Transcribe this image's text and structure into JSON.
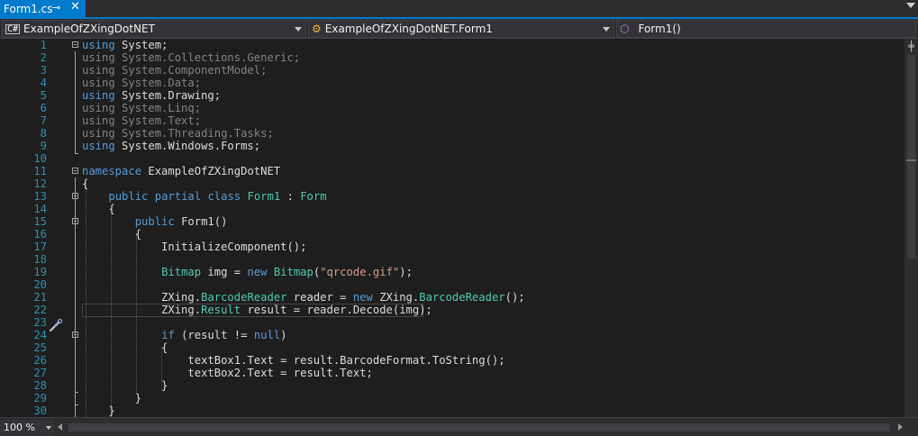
{
  "tab": {
    "title": "Form1.cs",
    "pin_glyph": "⊸",
    "close_glyph": "✕"
  },
  "nav": {
    "project": "ExampleOfZXingDotNET",
    "type": "ExampleOfZXingDotNET.Form1",
    "member": "Form1()"
  },
  "zoom": "100 %",
  "lines": [
    {
      "n": "1",
      "tokens": [
        [
          "kw",
          "using"
        ],
        [
          "tx",
          " System;"
        ]
      ]
    },
    {
      "n": "2",
      "tokens": [
        [
          "gr",
          "using System.Collections.Generic;"
        ]
      ]
    },
    {
      "n": "3",
      "tokens": [
        [
          "gr",
          "using System.ComponentModel;"
        ]
      ]
    },
    {
      "n": "4",
      "tokens": [
        [
          "gr",
          "using System.Data;"
        ]
      ]
    },
    {
      "n": "5",
      "tokens": [
        [
          "kw",
          "using"
        ],
        [
          "tx",
          " System.Drawing;"
        ]
      ]
    },
    {
      "n": "6",
      "tokens": [
        [
          "gr",
          "using System.Linq;"
        ]
      ]
    },
    {
      "n": "7",
      "tokens": [
        [
          "gr",
          "using System.Text;"
        ]
      ]
    },
    {
      "n": "8",
      "tokens": [
        [
          "gr",
          "using System.Threading.Tasks;"
        ]
      ]
    },
    {
      "n": "9",
      "tokens": [
        [
          "kw",
          "using"
        ],
        [
          "tx",
          " System.Windows.Forms;"
        ]
      ]
    },
    {
      "n": "10",
      "tokens": []
    },
    {
      "n": "11",
      "tokens": [
        [
          "kw",
          "namespace"
        ],
        [
          "tx",
          " ExampleOfZXingDotNET"
        ]
      ]
    },
    {
      "n": "12",
      "tokens": [
        [
          "tx",
          "{"
        ]
      ]
    },
    {
      "n": "13",
      "tokens": [
        [
          "tx",
          "    "
        ],
        [
          "kw",
          "public"
        ],
        [
          "tx",
          " "
        ],
        [
          "kw",
          "partial"
        ],
        [
          "tx",
          " "
        ],
        [
          "kw",
          "class"
        ],
        [
          "tx",
          " "
        ],
        [
          "ty",
          "Form1"
        ],
        [
          "tx",
          " : "
        ],
        [
          "ty",
          "Form"
        ]
      ]
    },
    {
      "n": "14",
      "tokens": [
        [
          "tx",
          "    {"
        ]
      ]
    },
    {
      "n": "15",
      "tokens": [
        [
          "tx",
          "        "
        ],
        [
          "kw",
          "public"
        ],
        [
          "tx",
          " Form1()"
        ]
      ]
    },
    {
      "n": "16",
      "tokens": [
        [
          "tx",
          "        {"
        ]
      ]
    },
    {
      "n": "17",
      "tokens": [
        [
          "tx",
          "            InitializeComponent();"
        ]
      ]
    },
    {
      "n": "18",
      "tokens": []
    },
    {
      "n": "19",
      "tokens": [
        [
          "tx",
          "            "
        ],
        [
          "ty",
          "Bitmap"
        ],
        [
          "tx",
          " img = "
        ],
        [
          "kw",
          "new"
        ],
        [
          "tx",
          " "
        ],
        [
          "ty",
          "Bitmap"
        ],
        [
          "tx",
          "("
        ],
        [
          "st",
          "\"qrcode.gif\""
        ],
        [
          "tx",
          ");"
        ]
      ]
    },
    {
      "n": "20",
      "tokens": []
    },
    {
      "n": "21",
      "tokens": [
        [
          "tx",
          "            ZXing."
        ],
        [
          "ty",
          "BarcodeReader"
        ],
        [
          "tx",
          " reader = "
        ],
        [
          "kw",
          "new"
        ],
        [
          "tx",
          " ZXing."
        ],
        [
          "ty",
          "BarcodeReader"
        ],
        [
          "tx",
          "();"
        ]
      ]
    },
    {
      "n": "22",
      "tokens": [
        [
          "tx",
          "            ZXing."
        ],
        [
          "ty",
          "Result"
        ],
        [
          "tx",
          " result = reader.Decode(img);"
        ]
      ]
    },
    {
      "n": "23",
      "tokens": []
    },
    {
      "n": "24",
      "tokens": [
        [
          "tx",
          "            "
        ],
        [
          "kw",
          "if"
        ],
        [
          "tx",
          " (result != "
        ],
        [
          "kw",
          "null"
        ],
        [
          "tx",
          ")"
        ]
      ]
    },
    {
      "n": "25",
      "tokens": [
        [
          "tx",
          "            {"
        ]
      ]
    },
    {
      "n": "26",
      "tokens": [
        [
          "tx",
          "                textBox1.Text = result.BarcodeFormat.ToString();"
        ]
      ]
    },
    {
      "n": "27",
      "tokens": [
        [
          "tx",
          "                textBox2.Text = result.Text;"
        ]
      ]
    },
    {
      "n": "28",
      "tokens": [
        [
          "tx",
          "            }"
        ]
      ]
    },
    {
      "n": "29",
      "tokens": [
        [
          "tx",
          "        }"
        ]
      ]
    },
    {
      "n": "30",
      "tokens": [
        [
          "tx",
          "    }"
        ]
      ]
    }
  ]
}
